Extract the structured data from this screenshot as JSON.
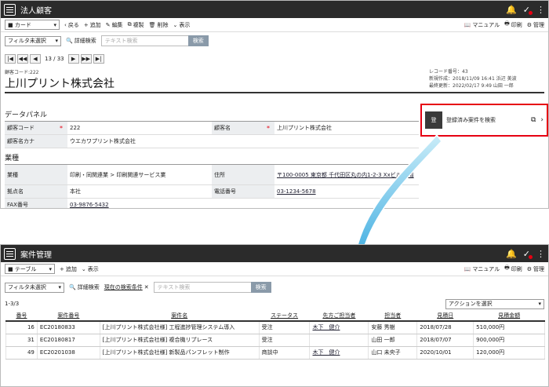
{
  "top": {
    "title": "法人顧客",
    "view_select": "カード",
    "toolbar": {
      "back": "戻る",
      "add": "追加",
      "edit": "編集",
      "copy": "複製",
      "delete": "削除",
      "display": "表示",
      "manual": "マニュアル",
      "print": "印刷",
      "admin": "管理"
    },
    "filter_select": "フィルタ未選択",
    "detail_search": "詳細検索",
    "search_placeholder": "テキスト検索",
    "search_button": "検索",
    "pager": {
      "text": "13 / 33",
      "first": "|◀",
      "prev2": "◀◀",
      "prev": "◀",
      "next": "▶",
      "next2": "▶▶",
      "last": "▶|"
    },
    "record": {
      "code_label": "顧客コード:222",
      "name": "上川プリント株式会社",
      "record_no": "レコード番号：43",
      "created": "新規作成：2018/11/09 16:41 浜辺 美波",
      "updated": "最終更新：2022/02/17 9:49 山田 一郎"
    },
    "datapanel": {
      "title": "データパネル",
      "rows1": [
        {
          "l1": "顧客コード",
          "v1": "222",
          "l2": "顧客名",
          "v2": "上川プリント株式会社"
        },
        {
          "l1": "顧客名カナ",
          "v1": "ウエカワプリント株式会社",
          "l2": "",
          "v2": ""
        }
      ],
      "section2": "業種",
      "rows2": [
        {
          "l1": "業種",
          "v1": "印刷・同関連業 > 印刷関連サービス業",
          "l2": "住所",
          "v2": "〒100-0005 東京都 千代田区丸の内1-2-3 Xxビル17階"
        },
        {
          "l1": "拠点名",
          "v1": "本社",
          "l2": "電話番号",
          "v2": "03-1234-5678"
        },
        {
          "l1": "FAX番号",
          "v1": "03-9876-5432",
          "l2": "",
          "v2": ""
        }
      ]
    },
    "side": {
      "icon_text": "登",
      "label": "登録済み案件を検索"
    }
  },
  "bottom": {
    "title": "案件管理",
    "view_select": "テーブル",
    "toolbar": {
      "add": "追加",
      "display": "表示",
      "manual": "マニュアル",
      "print": "印刷",
      "admin": "管理"
    },
    "filter_select": "フィルタ未選択",
    "detail_search": "詳細検索",
    "current_condition": "現在の検索条件",
    "search_placeholder": "テキスト検索",
    "search_button": "検索",
    "count": "1-3/3",
    "action_select": "アクションを選択",
    "columns": [
      "番号",
      "案件番号",
      "案件名",
      "ステータス",
      "先方ご担当者",
      "担当者",
      "見積日",
      "見積金額"
    ],
    "rows": [
      [
        "16",
        "EC20180833",
        "[上川プリント株式会社様] 工程進捗管理システム導入",
        "受注",
        "木下　健介",
        "安藤 秀樹",
        "2018/07/28",
        "510,000円"
      ],
      [
        "31",
        "EC20180817",
        "[上川プリント株式会社様] 複合機リプレース",
        "受注",
        "",
        "山田 一郎",
        "2018/07/07",
        "900,000円"
      ],
      [
        "49",
        "EC20201038",
        "[上川プリント株式会社様] 新製品パンフレット制作",
        "商談中",
        "木下　健介",
        "山口 未央子",
        "2020/10/01",
        "120,000円"
      ]
    ]
  }
}
